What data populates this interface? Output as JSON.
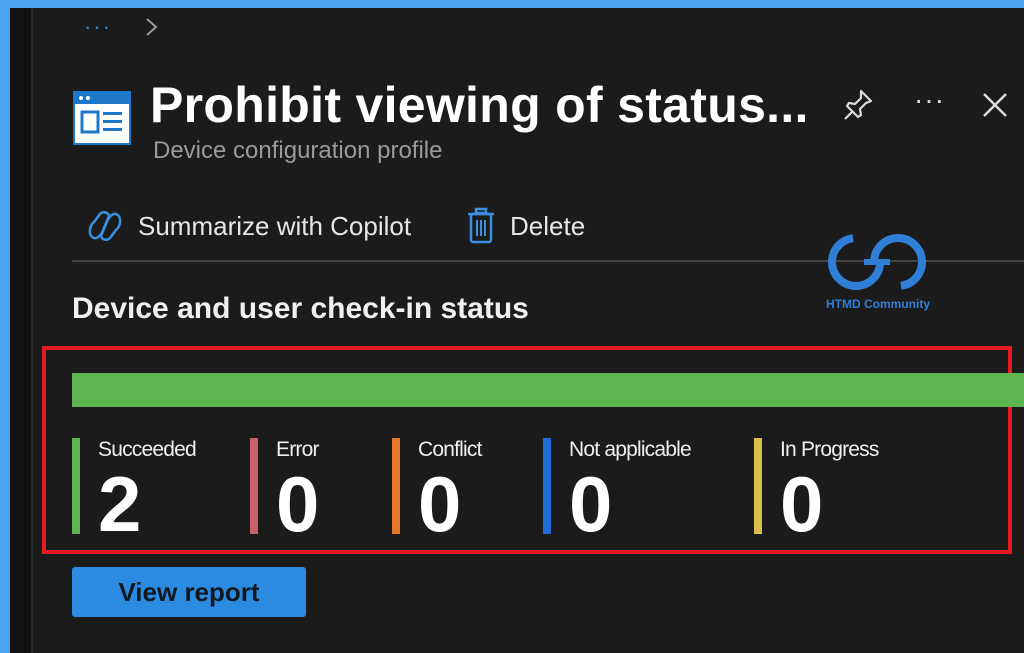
{
  "breadcrumb": {
    "ellipsis": "···"
  },
  "header": {
    "title": "Prohibit viewing of status...",
    "subtitle": "Device configuration profile",
    "more_label": "···"
  },
  "commands": {
    "copilot_label": "Summarize with Copilot",
    "delete_label": "Delete"
  },
  "watermark": {
    "text": "HTMD Community"
  },
  "checkin": {
    "title": "Device and user check-in status",
    "progress_fraction_succeeded": 1.0,
    "stats": [
      {
        "label": "Succeeded",
        "value": "2",
        "color": "#5cb54e"
      },
      {
        "label": "Error",
        "value": "0",
        "color": "#c8616c"
      },
      {
        "label": "Conflict",
        "value": "0",
        "color": "#e8762b"
      },
      {
        "label": "Not applicable",
        "value": "0",
        "color": "#1f6ed8"
      },
      {
        "label": "In Progress",
        "value": "0",
        "color": "#d8c04a"
      }
    ]
  },
  "actions": {
    "view_report_label": "View report"
  },
  "colors": {
    "accent": "#2b8be0",
    "highlight_border": "#e31b23",
    "background": "#1b1b1b"
  }
}
